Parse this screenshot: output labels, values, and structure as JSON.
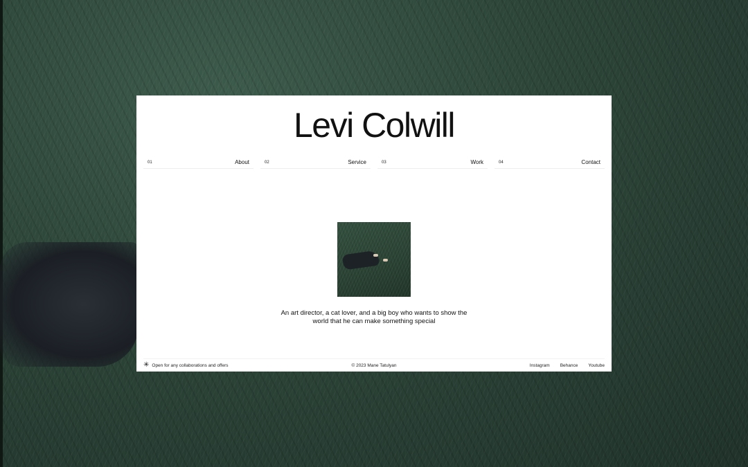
{
  "site": {
    "title": "Levi Colwill"
  },
  "nav": [
    {
      "num": "01",
      "label": "About"
    },
    {
      "num": "02",
      "label": "Service"
    },
    {
      "num": "03",
      "label": "Work"
    },
    {
      "num": "04",
      "label": "Contact"
    }
  ],
  "hero": {
    "tagline_line1": "An art director, a cat lover, and a big boy who wants to show the",
    "tagline_line2": "world that he can make something special"
  },
  "footer": {
    "status_icon": "asterisk-icon",
    "status": "Open for any collaborations and offers",
    "copyright": "© 2023 Mane Tatulyan",
    "links": [
      "Instagram",
      "Behance",
      "Youtube"
    ]
  },
  "colors": {
    "background": "#2c4438",
    "card": "#ffffff",
    "text": "#111111"
  }
}
